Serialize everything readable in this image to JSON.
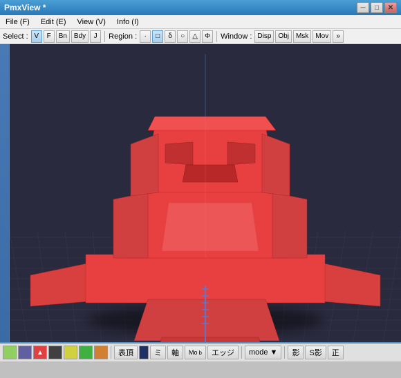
{
  "window": {
    "title": "PmxView *",
    "title_btn_min": "─",
    "title_btn_max": "□",
    "title_btn_close": "✕"
  },
  "menu": {
    "file": "File (F)",
    "edit": "Edit (E)",
    "view": "View (V)",
    "info": "Info (I)"
  },
  "toolbar": {
    "select_label": "Select :",
    "btn_v": "V",
    "btn_f": "F",
    "btn_bn": "Bn",
    "btn_bdy": "Bdy",
    "btn_j": "J",
    "region_label": "Region :",
    "btn_dot": "·",
    "btn_rect": "□",
    "btn_delta": "δ",
    "btn_circle": "○",
    "btn_triangle": "△",
    "btn_phi": "Φ",
    "window_label": "Window :",
    "btn_disp": "Disp",
    "btn_obj": "Obj",
    "btn_msk": "Msk",
    "btn_mov": "Mov",
    "btn_more": "»"
  },
  "nav_buttons": {
    "btn1": "⊕",
    "btn2": "+",
    "btn3": "↺",
    "btn4": "↻"
  },
  "status": {
    "btn_hyomen": "表頂",
    "btn_mi": "ミ",
    "btn_jiku": "軸",
    "btn_bone": "Mo",
    "btn_edge": "エッジ",
    "btn_mode": "mode ▼",
    "btn_kage": "影",
    "btn_skage": "S影",
    "btn_sei": "正"
  },
  "colors": {
    "accent_blue": "#3a7dbf",
    "model_red": "#e84040",
    "model_red_dark": "#c03030",
    "model_red_light": "#f08080",
    "grid_color": "#3a3a5a",
    "bg_color": "#2a2a3e"
  }
}
